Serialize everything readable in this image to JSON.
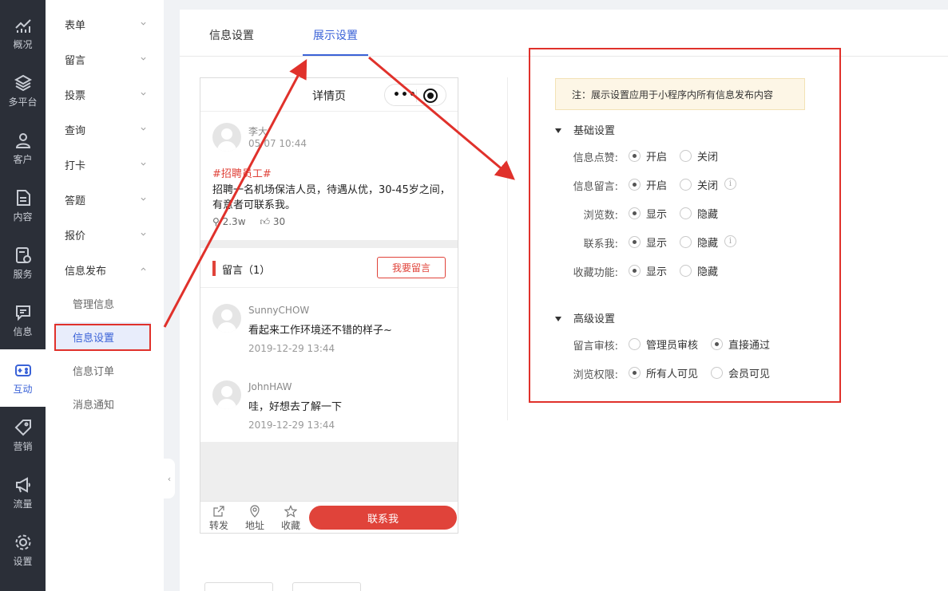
{
  "rail": [
    {
      "label": "概况",
      "icon": "chart-icon"
    },
    {
      "label": "多平台",
      "icon": "layers-icon"
    },
    {
      "label": "客户",
      "icon": "user-icon"
    },
    {
      "label": "内容",
      "icon": "document-icon"
    },
    {
      "label": "服务",
      "icon": "service-icon"
    },
    {
      "label": "信息",
      "icon": "message-icon"
    },
    {
      "label": "互动",
      "icon": "gamepad-icon",
      "active": true
    },
    {
      "label": "营销",
      "icon": "tag-icon"
    },
    {
      "label": "流量",
      "icon": "megaphone-icon"
    },
    {
      "label": "设置",
      "icon": "settings-icon"
    }
  ],
  "submenu": {
    "groups": [
      "表单",
      "留言",
      "投票",
      "查询",
      "打卡",
      "答题",
      "报价",
      "信息发布"
    ],
    "children": [
      "管理信息",
      "信息设置",
      "信息订单",
      "消息通知"
    ],
    "active_child": "信息设置"
  },
  "tabs": [
    "信息设置",
    "展示设置"
  ],
  "active_tab": "展示设置",
  "phone": {
    "title": "详情页",
    "post": {
      "name": "李大",
      "time": "05/07 10:44",
      "tag": "#招聘员工#",
      "body": "招聘一名机场保洁人员，待遇从优，30-45岁之间，有意者可联系我。",
      "views": "2.3w",
      "likes": "30"
    },
    "comments_title": "留言（1）",
    "comment_button": "我要留言",
    "comments": [
      {
        "name": "SunnyCHOW",
        "text": "看起来工作环境还不错的样子~",
        "time": "2019-12-29 13:44"
      },
      {
        "name": "JohnHAW",
        "text": "哇，好想去了解一下",
        "time": "2019-12-29 13:44"
      }
    ],
    "footer": {
      "share": "转发",
      "address": "地址",
      "favorite": "收藏",
      "contact": "联系我"
    }
  },
  "settings": {
    "notice": "注：展示设置应用于小程序内所有信息发布内容",
    "basic_title": "基础设置",
    "basic": [
      {
        "label": "信息点赞:",
        "opt1": "开启",
        "opt2": "关闭",
        "selected": 1,
        "info": false
      },
      {
        "label": "信息留言:",
        "opt1": "开启",
        "opt2": "关闭",
        "selected": 1,
        "info": true
      },
      {
        "label": "浏览数:",
        "opt1": "显示",
        "opt2": "隐藏",
        "selected": 1,
        "info": false
      },
      {
        "label": "联系我:",
        "opt1": "显示",
        "opt2": "隐藏",
        "selected": 1,
        "info": true
      },
      {
        "label": "收藏功能:",
        "opt1": "显示",
        "opt2": "隐藏",
        "selected": 1,
        "info": false
      }
    ],
    "advanced_title": "高级设置",
    "advanced": [
      {
        "label": "留言审核:",
        "opt1": "管理员审核",
        "opt2": "直接通过",
        "selected": 2
      },
      {
        "label": "浏览权限:",
        "opt1": "所有人可见",
        "opt2": "会员可见",
        "selected": 1
      }
    ]
  },
  "colors": {
    "accent": "#3a62d7",
    "annotation": "#e0312b",
    "brand_red": "#e0433a",
    "rail_bg": "#2b2f38"
  }
}
